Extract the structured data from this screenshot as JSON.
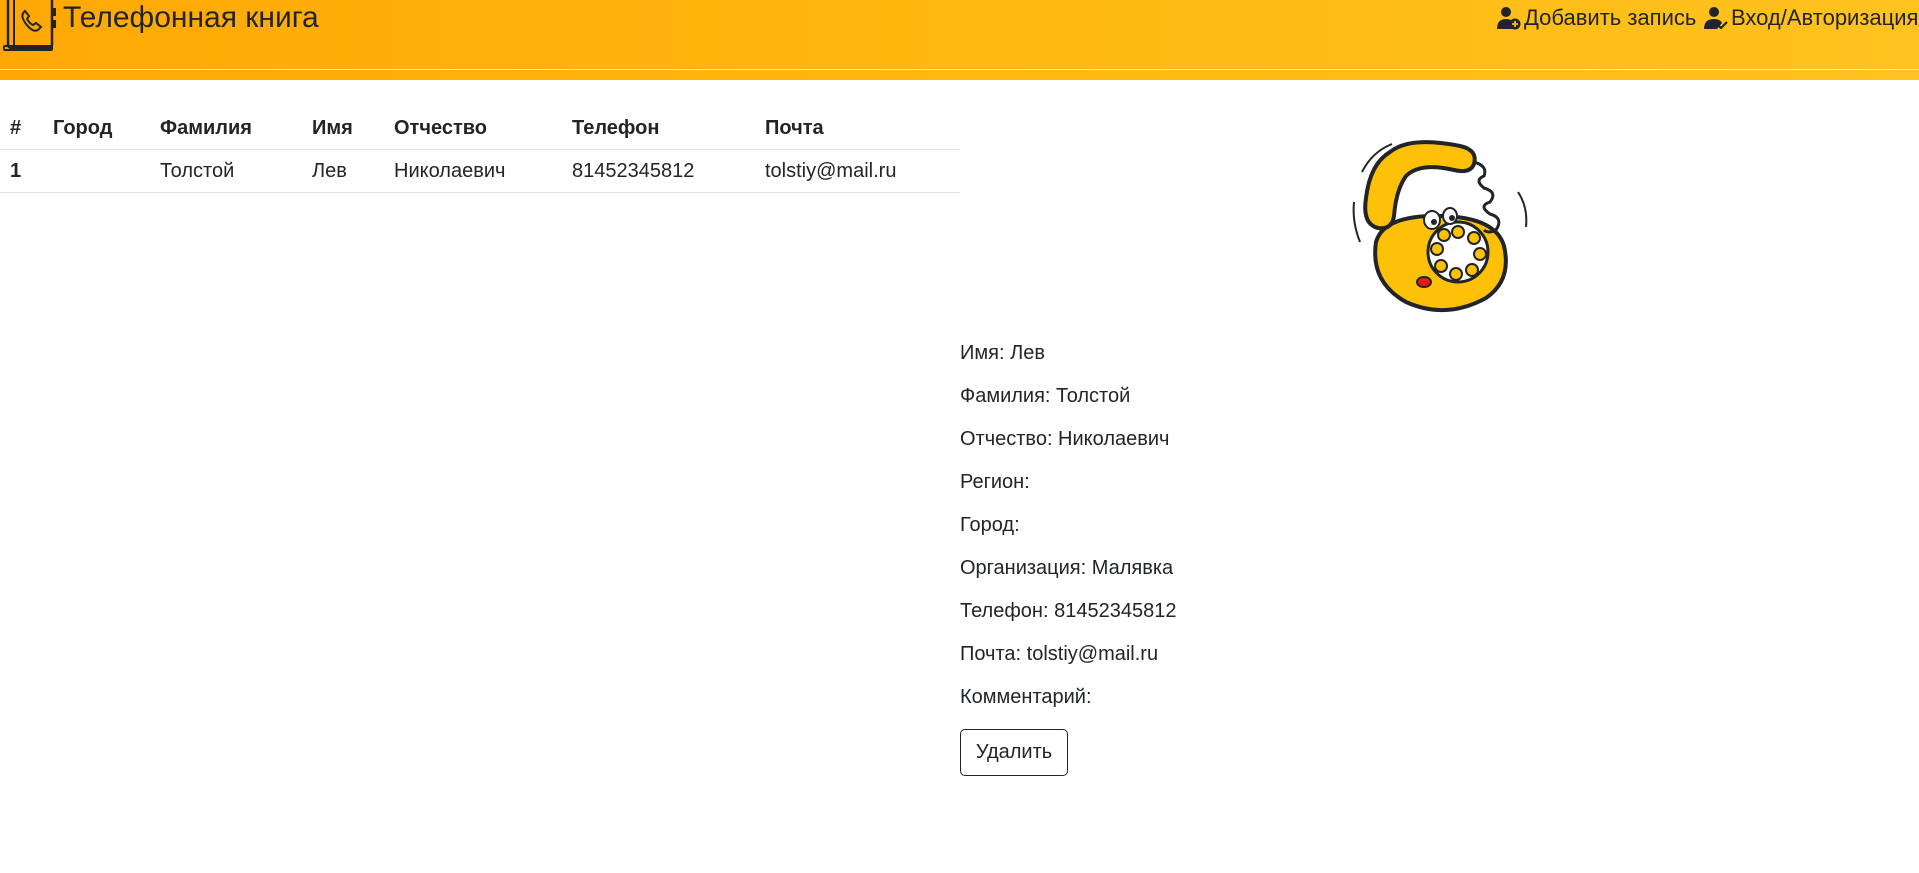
{
  "header": {
    "brand": "Телефонная книга",
    "add_record": "Добавить запись",
    "login": "Вход/Авторизация"
  },
  "table": {
    "columns": [
      "#",
      "Город",
      "Фамилия",
      "Имя",
      "Отчество",
      "Телефон",
      "Почта"
    ],
    "rows": [
      {
        "num": "1",
        "city": "",
        "last_name": "Толстой",
        "first_name": "Лев",
        "middle_name": "Николаевич",
        "phone": "81452345812",
        "email": "tolstiy@mail.ru"
      }
    ]
  },
  "detail": {
    "first_name": "Имя: Лев",
    "last_name": "Фамилия: Толстой",
    "middle_name": "Отчество: Николаевич",
    "region": "Регион:",
    "city": "Город:",
    "organization": "Организация: Малявка",
    "phone": "Телефон: 81452345812",
    "email": "Почта: tolstiy@mail.ru",
    "comment": "Комментарий:",
    "delete_label": "Удалить"
  },
  "colors": {
    "header_start": "#ffa805",
    "header_end": "#ffc220",
    "phone_yellow": "#ffc107"
  },
  "icons": {
    "logo": "phonebook-icon",
    "add": "add-user-icon",
    "login": "user-check-icon",
    "picture": "rotary-phone-illustration"
  }
}
